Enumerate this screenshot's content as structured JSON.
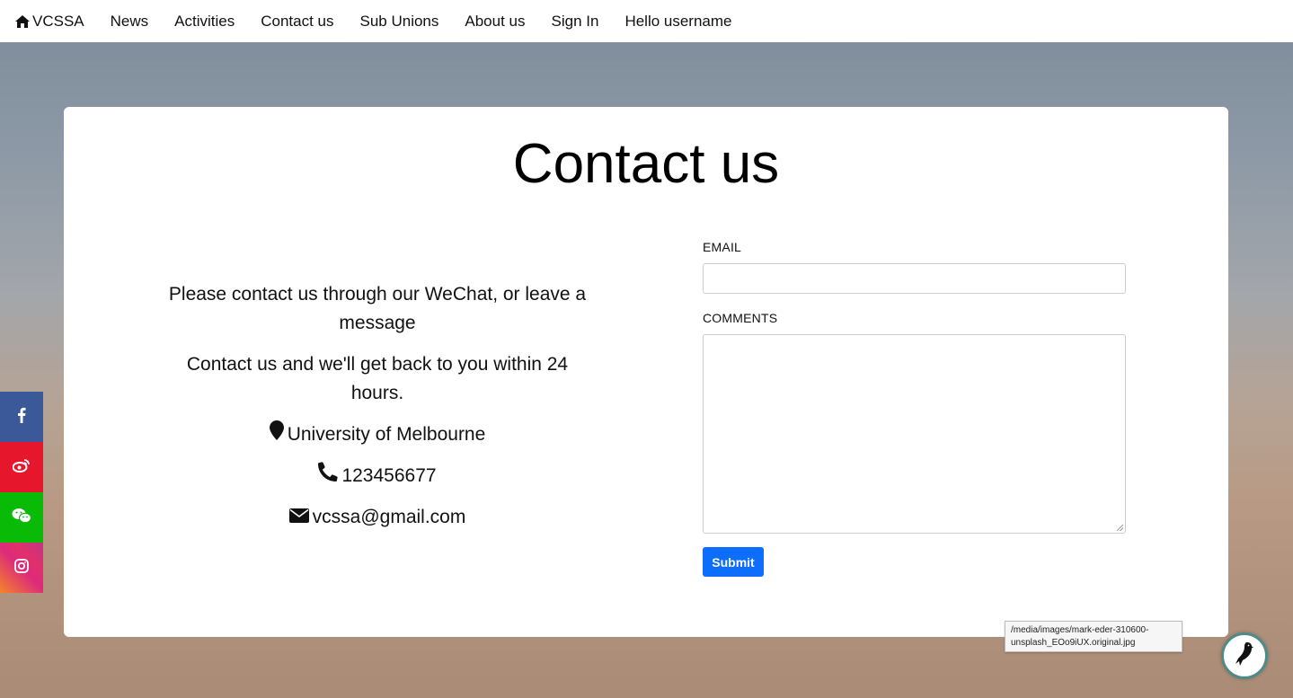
{
  "nav": {
    "brand": "VCSSA",
    "items": [
      "News",
      "Activities",
      "Contact us",
      "Sub Unions",
      "About us",
      "Sign In",
      "Hello username"
    ]
  },
  "page": {
    "title": "Contact us"
  },
  "info": {
    "message1": "Please contact us through our WeChat, or leave a message",
    "message2": "Contact us and we'll get back to you within 24 hours.",
    "location": "University of Melbourne",
    "phone": "123456677",
    "email": "vcssa@gmail.com"
  },
  "form": {
    "email_label": "EMAIL",
    "email_value": "",
    "comments_label": "COMMENTS",
    "comments_value": "",
    "submit_label": "Submit"
  },
  "social": [
    "facebook-icon",
    "weibo-icon",
    "wechat-icon",
    "instagram-icon"
  ],
  "tooltip": {
    "text": "/media/images/mark-eder-310600-unsplash_EOo9iUX.original.jpg"
  },
  "colors": {
    "submit": "#0d6efd",
    "facebook": "#3b5998",
    "weibo": "#e6162d",
    "wechat": "#09bb07"
  }
}
